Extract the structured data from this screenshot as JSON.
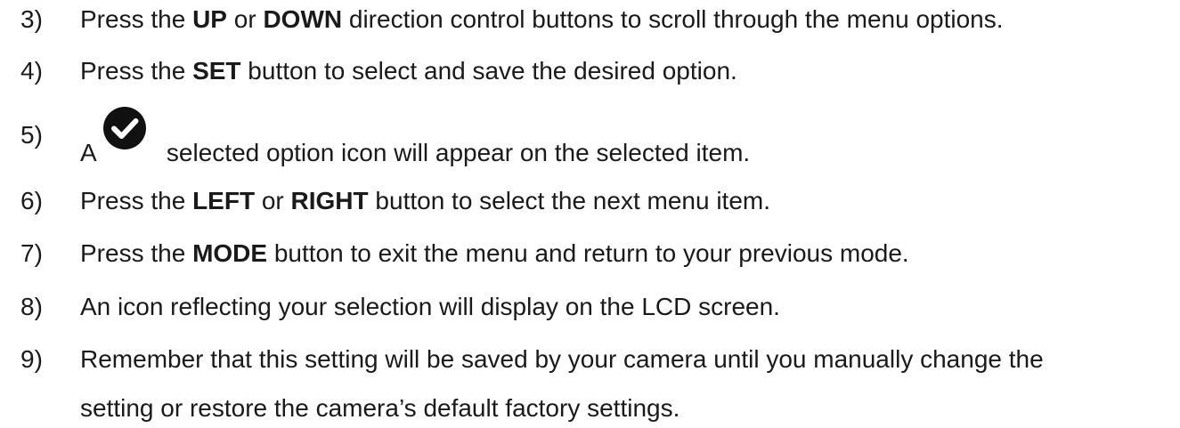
{
  "steps": [
    {
      "number": "3)",
      "parts": [
        {
          "t": "Press the "
        },
        {
          "t": "UP",
          "b": true
        },
        {
          "t": " or "
        },
        {
          "t": "DOWN",
          "b": true
        },
        {
          "t": " direction control buttons to scroll through the menu options."
        }
      ]
    },
    {
      "number": "4)",
      "parts": [
        {
          "t": "Press the "
        },
        {
          "t": "SET",
          "b": true
        },
        {
          "t": " button to select and save the desired option."
        }
      ]
    },
    {
      "number": "5)",
      "parts": [
        {
          "t": "A "
        },
        {
          "icon": "check-icon"
        },
        {
          "t": "selected option icon will appear on the selected item."
        }
      ]
    },
    {
      "number": "6)",
      "parts": [
        {
          "t": "Press the "
        },
        {
          "t": "LEFT",
          "b": true
        },
        {
          "t": " or "
        },
        {
          "t": "RIGHT",
          "b": true
        },
        {
          "t": " button to select the next menu item."
        }
      ]
    },
    {
      "number": "7)",
      "parts": [
        {
          "t": "Press the "
        },
        {
          "t": "MODE",
          "b": true
        },
        {
          "t": " button to exit the menu and return to your previous mode."
        }
      ]
    },
    {
      "number": "8)",
      "parts": [
        {
          "t": "An icon reflecting your selection will display on the LCD screen."
        }
      ]
    },
    {
      "number": "9)",
      "parts": [
        {
          "t": "Remember that this setting will be saved by your camera until you manually change the"
        }
      ],
      "continuation": "setting or restore the camera’s default factory settings."
    }
  ]
}
